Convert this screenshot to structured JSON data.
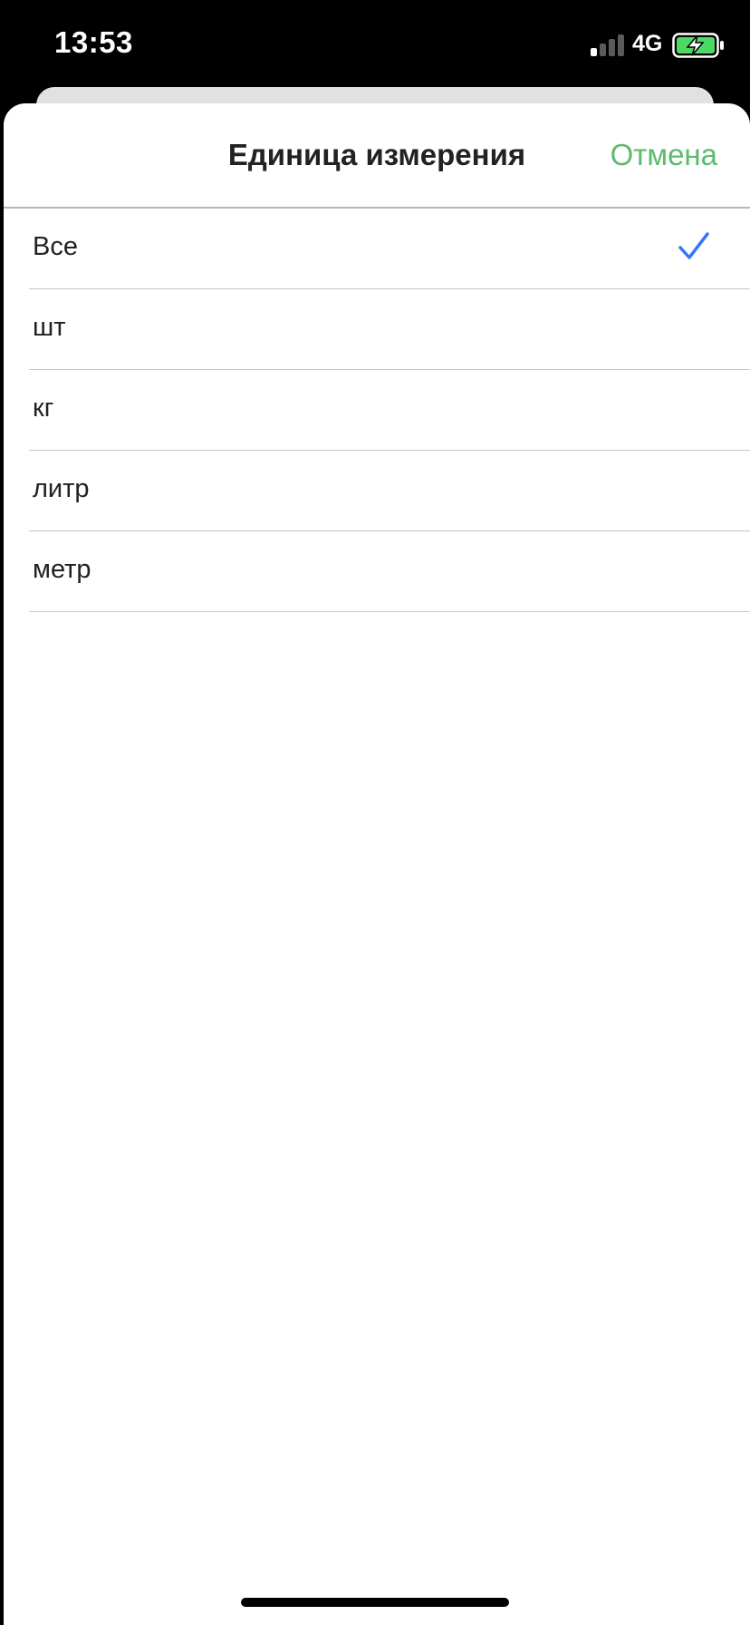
{
  "status_bar": {
    "time": "13:53",
    "network": "4G",
    "signal_bars_active": 1,
    "signal_bars_total": 4,
    "battery_charging": true
  },
  "sheet": {
    "title": "Единица измерения",
    "cancel_label": "Отмена"
  },
  "options": [
    {
      "label": "Все",
      "selected": true
    },
    {
      "label": "шт",
      "selected": false
    },
    {
      "label": "кг",
      "selected": false
    },
    {
      "label": "литр",
      "selected": false
    },
    {
      "label": "метр",
      "selected": false
    }
  ],
  "colors": {
    "accent_green": "#5cba6d",
    "check_blue": "#3478f6",
    "battery_green": "#4cd964"
  },
  "icons": {
    "selected_marker": "checkmark-icon",
    "battery": "battery-charging-icon",
    "signal": "cellular-signal-icon"
  }
}
